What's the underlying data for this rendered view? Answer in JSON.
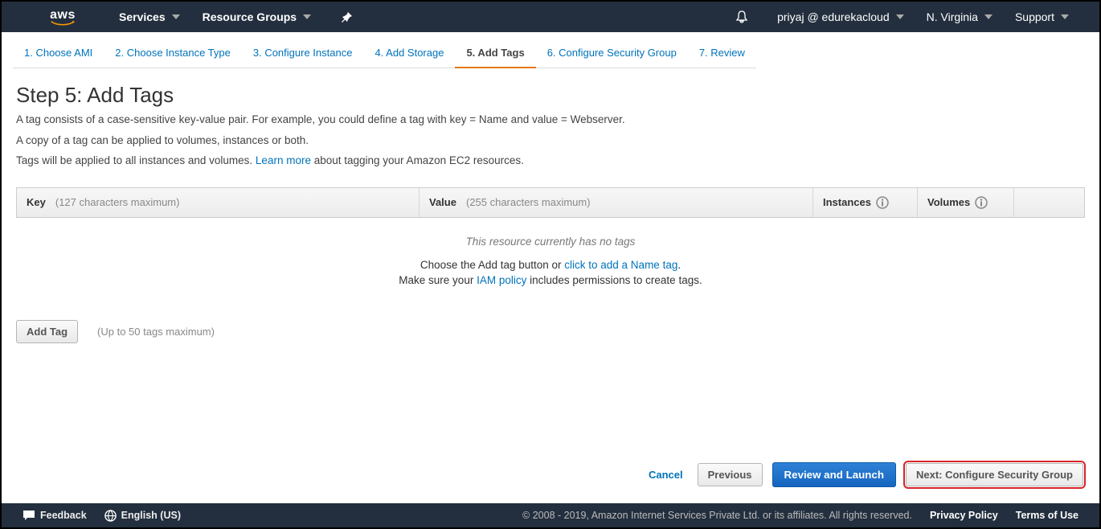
{
  "topnav": {
    "services": "Services",
    "resource_groups": "Resource Groups",
    "account": "priyaj @ edurekacloud",
    "region": "N. Virginia",
    "support": "Support"
  },
  "tabs": [
    "1. Choose AMI",
    "2. Choose Instance Type",
    "3. Configure Instance",
    "4. Add Storage",
    "5. Add Tags",
    "6. Configure Security Group",
    "7. Review"
  ],
  "active_tab_index": 4,
  "page": {
    "title": "Step 5: Add Tags",
    "desc1": "A tag consists of a case-sensitive key-value pair. For example, you could define a tag with key = Name and value = Webserver.",
    "desc2": "A copy of a tag can be applied to volumes, instances or both.",
    "desc3a": "Tags will be applied to all instances and volumes. ",
    "learn_more": "Learn more",
    "desc3b": " about tagging your Amazon EC2 resources."
  },
  "headers": {
    "key": "Key",
    "key_hint": "(127 characters maximum)",
    "value": "Value",
    "value_hint": "(255 characters maximum)",
    "instances": "Instances",
    "volumes": "Volumes"
  },
  "notags": "This resource currently has no tags",
  "choose_prefix": "Choose the Add tag button or ",
  "click_to_add": "click to add a Name tag",
  "choose_suffix": ".",
  "iam_prefix": "Make sure your ",
  "iam_link": "IAM policy",
  "iam_suffix": " includes permissions to create tags.",
  "add_tag_btn": "Add Tag",
  "add_tag_hint": "(Up to 50 tags maximum)",
  "buttons": {
    "cancel": "Cancel",
    "previous": "Previous",
    "review": "Review and Launch",
    "next": "Next: Configure Security Group"
  },
  "bottombar": {
    "feedback": "Feedback",
    "language": "English (US)",
    "copyright": "© 2008 - 2019, Amazon Internet Services Private Ltd. or its affiliates. All rights reserved.",
    "privacy": "Privacy Policy",
    "terms": "Terms of Use"
  }
}
